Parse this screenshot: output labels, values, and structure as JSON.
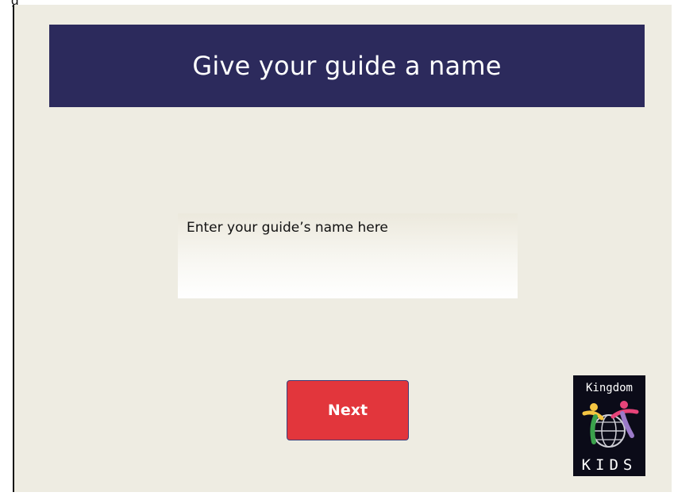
{
  "header": {
    "top_caption": "g"
  },
  "slide": {
    "title": "Give your guide a name",
    "name_input": {
      "placeholder": "Enter your guide’s name here",
      "value": ""
    },
    "next_button": {
      "label": "Next"
    },
    "logo": {
      "icon": "kingdom-kids-logo",
      "top_text": "Kingdom",
      "bottom_text": "KIDS"
    }
  },
  "colors": {
    "background": "#eeece2",
    "title_bar": "#2c2a5c",
    "title_text": "#ffffff",
    "button": "#e2363c",
    "button_border": "#3d3f7a",
    "logo_background": "#0b0b18"
  }
}
